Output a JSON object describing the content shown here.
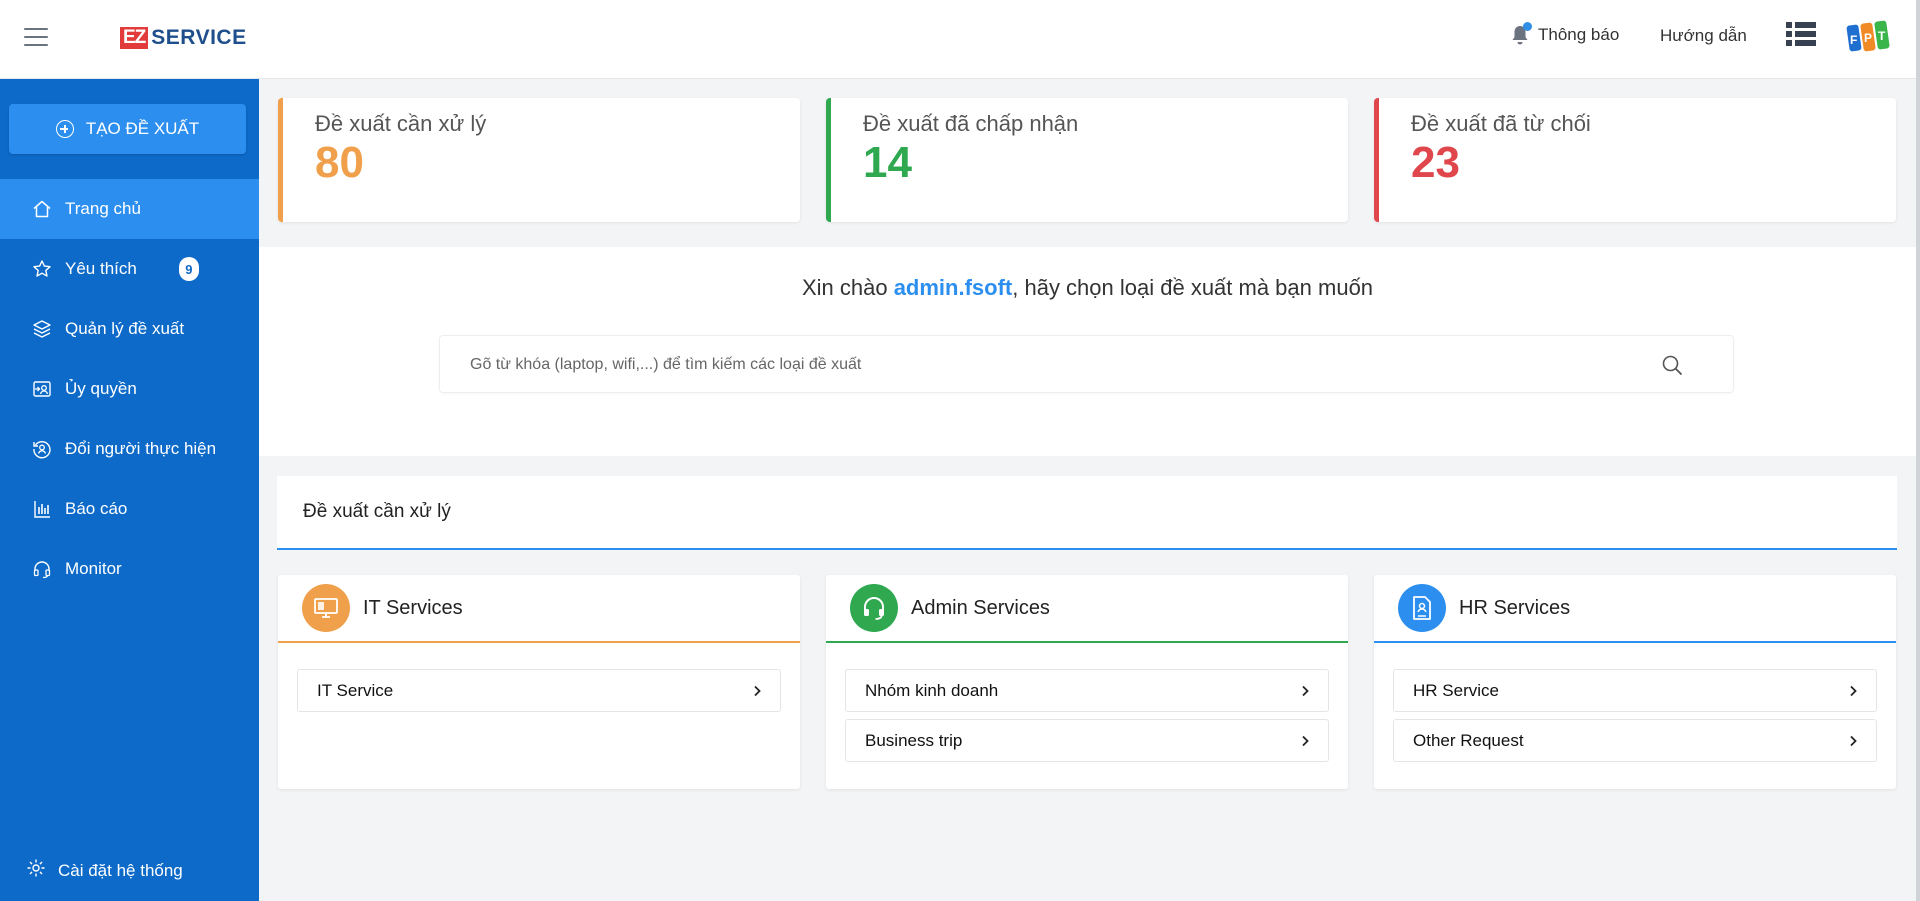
{
  "header": {
    "logo_ez": "EZ",
    "logo_service": "SERVICE",
    "notifications_label": "Thông báo",
    "guide_label": "Hướng dẫn"
  },
  "sidebar": {
    "create_button": "TẠO ĐỀ XUẤT",
    "items": [
      {
        "label": "Trang chủ",
        "icon": "home-icon"
      },
      {
        "label": "Yêu thích",
        "icon": "star-icon",
        "badge": "9"
      },
      {
        "label": "Quản lý đề xuất",
        "icon": "layers-icon"
      },
      {
        "label": "Ủy quyền",
        "icon": "delegate-icon"
      },
      {
        "label": "Đổi người thực hiện",
        "icon": "change-user-icon"
      },
      {
        "label": "Báo cáo",
        "icon": "bar-chart-icon"
      },
      {
        "label": "Monitor",
        "icon": "headset-icon"
      }
    ],
    "settings_label": "Cài đặt hệ thống"
  },
  "stats": [
    {
      "title": "Đề xuất cần xử lý",
      "value": "80",
      "color": "#f0a04b"
    },
    {
      "title": "Đề xuất đã chấp nhận",
      "value": "14",
      "color": "#2fa84f"
    },
    {
      "title": "Đề xuất đã từ chối",
      "value": "23",
      "color": "#e0474c"
    }
  ],
  "welcome": {
    "prefix": "Xin chào ",
    "user": "admin.fsoft",
    "suffix": ", hãy chọn loại đề xuất mà bạn muốn"
  },
  "search": {
    "placeholder": "Gõ từ khóa (laptop, wifi,...) để tìm kiếm các loại đề xuất",
    "value": ""
  },
  "pending_section_title": "Đề xuất cần xử lý",
  "services": [
    {
      "title": "IT Services",
      "color": "#f0a04b",
      "icon": "monitor-icon",
      "items": [
        "IT Service"
      ]
    },
    {
      "title": "Admin Services",
      "color": "#2fa84f",
      "icon": "headset-icon",
      "items": [
        "Nhóm kinh doanh",
        "Business trip"
      ]
    },
    {
      "title": "HR Services",
      "color": "#2c8ff0",
      "icon": "id-document-icon",
      "items": [
        "HR Service",
        "Other Request"
      ]
    }
  ]
}
